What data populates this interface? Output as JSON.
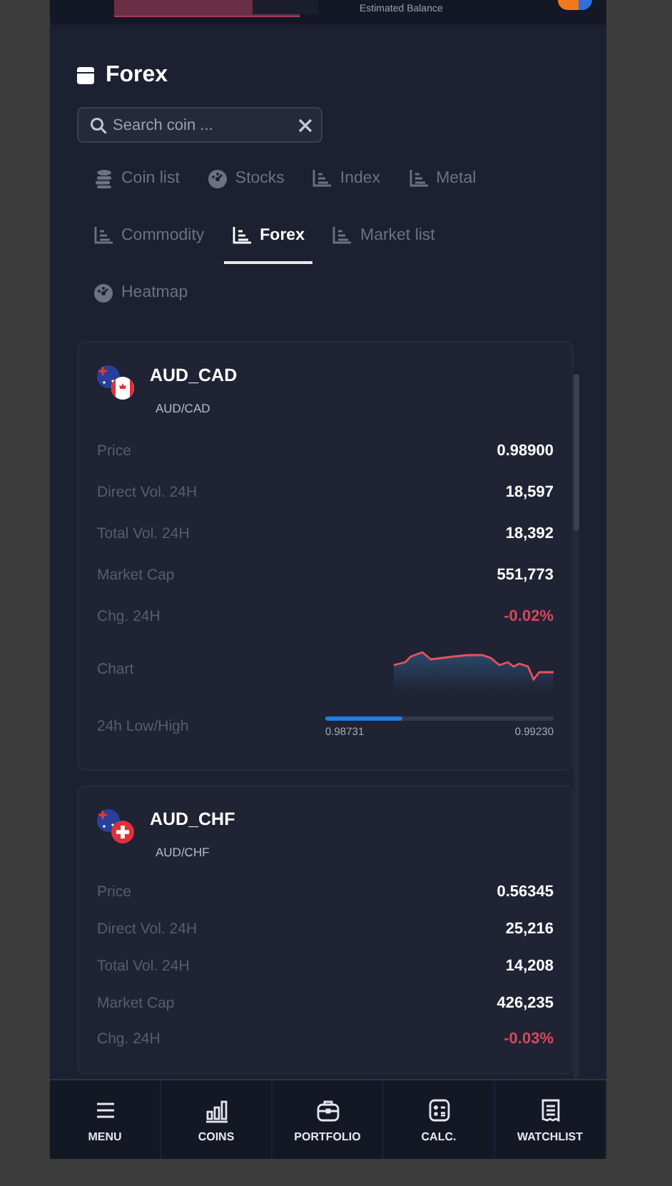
{
  "header": {
    "balance_label": "Estimated Balance"
  },
  "page": {
    "title": "Forex"
  },
  "search": {
    "placeholder": "Search coin ..."
  },
  "tabs": [
    {
      "label": "Coin list",
      "selected": false
    },
    {
      "label": "Stocks",
      "selected": false
    },
    {
      "label": "Index",
      "selected": false
    },
    {
      "label": "Metal",
      "selected": false
    },
    {
      "label": "Commodity",
      "selected": false
    },
    {
      "label": "Forex",
      "selected": true
    },
    {
      "label": "Market list",
      "selected": false
    },
    {
      "label": "Heatmap",
      "selected": false
    }
  ],
  "pairs": [
    {
      "symbol": "AUD_CAD",
      "name": "AUD/CAD",
      "rows": [
        {
          "kind": "value",
          "label": "Price",
          "value": "0.98900"
        },
        {
          "kind": "value",
          "label": "Direct Vol. 24H",
          "value": "18,597"
        },
        {
          "kind": "value",
          "label": "Total Vol. 24H",
          "value": "18,392"
        },
        {
          "kind": "value",
          "label": "Market Cap",
          "value": "551,773"
        },
        {
          "kind": "change",
          "label": "Chg. 24H",
          "value": "-0.02%"
        },
        {
          "kind": "chart",
          "label": "Chart"
        },
        {
          "kind": "range",
          "label": "24h Low/High",
          "low": "0.98731",
          "high": "0.99230",
          "level": 0.34
        }
      ]
    },
    {
      "symbol": "AUD_CHF",
      "name": "AUD/CHF",
      "rows": [
        {
          "kind": "value",
          "label": "Price",
          "value": "0.56345"
        },
        {
          "kind": "value",
          "label": "Direct Vol. 24H",
          "value": "25,216"
        },
        {
          "kind": "value",
          "label": "Total Vol. 24H",
          "value": "14,208"
        },
        {
          "kind": "value",
          "label": "Market Cap",
          "value": "426,235"
        },
        {
          "kind": "change",
          "label": "Chg. 24H",
          "value": "-0.03%"
        }
      ]
    }
  ],
  "nav": [
    {
      "label": "MENU"
    },
    {
      "label": "COINS"
    },
    {
      "label": "PORTFOLIO"
    },
    {
      "label": "CALC."
    },
    {
      "label": "WATCHLIST"
    }
  ]
}
